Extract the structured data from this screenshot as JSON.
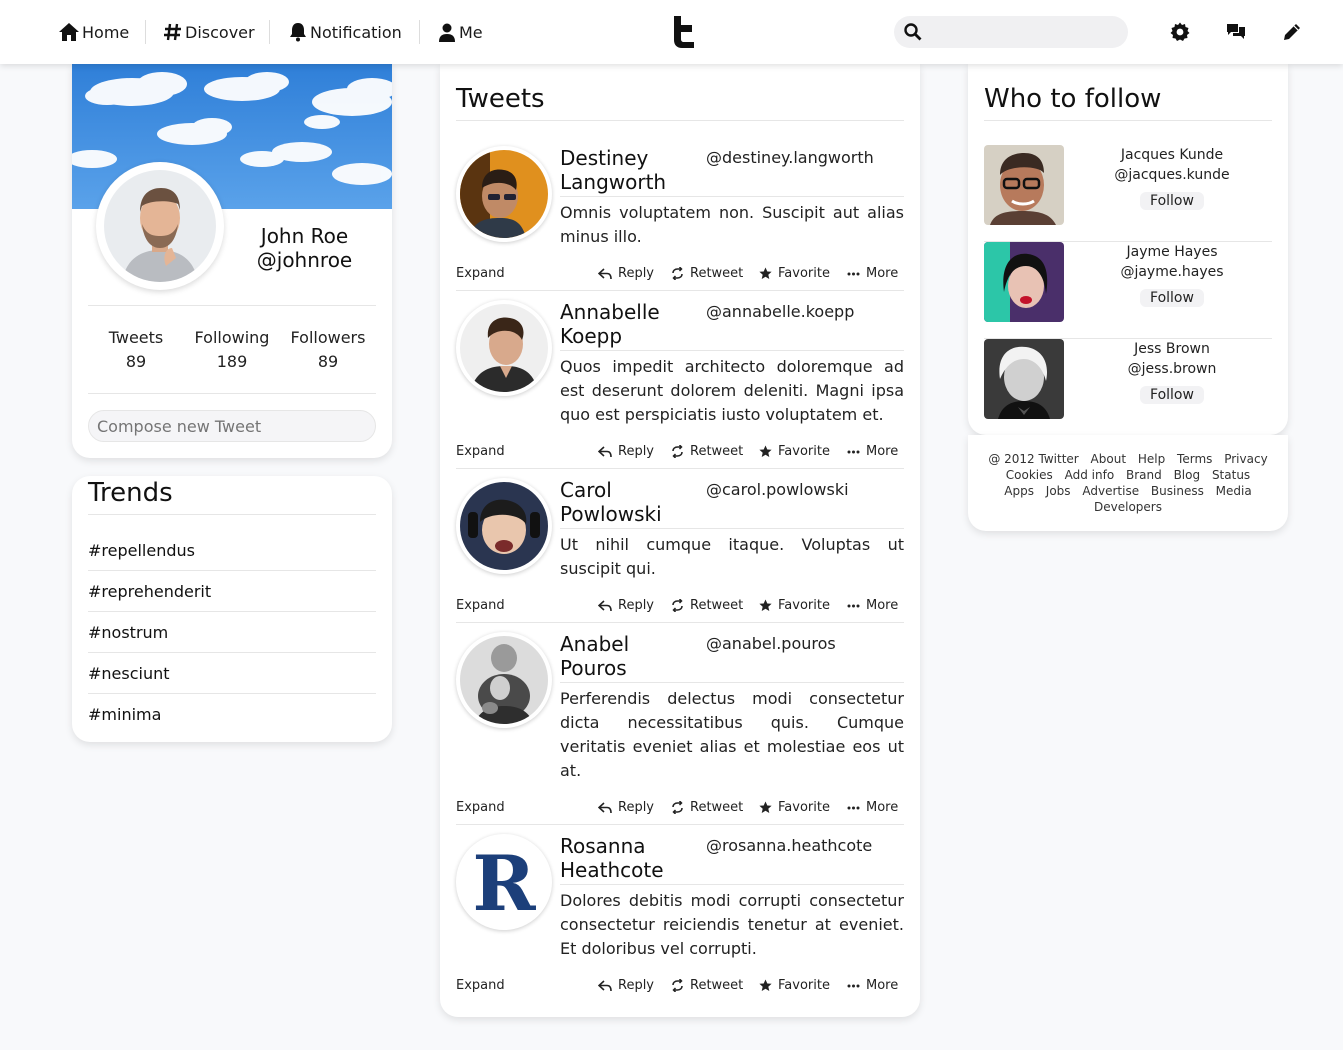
{
  "nav": {
    "home": "Home",
    "discover": "Discover",
    "notification": "Notification",
    "me": "Me",
    "search_placeholder": ""
  },
  "profile": {
    "name": "John Roe",
    "handle": "@johnroe",
    "stats": [
      {
        "label": "Tweets",
        "value": "89"
      },
      {
        "label": "Following",
        "value": "189"
      },
      {
        "label": "Followers",
        "value": "89"
      }
    ],
    "compose_placeholder": "Compose new Tweet"
  },
  "trends": {
    "title": "Trends",
    "items": [
      "#repellendus",
      "#reprehenderit",
      "#nostrum",
      "#nesciunt",
      "#minima"
    ]
  },
  "tweets": {
    "title": "Tweets",
    "actions": {
      "expand": "Expand",
      "reply": "Reply",
      "retweet": "Retweet",
      "favorite": "Favorite",
      "more": "More"
    },
    "items": [
      {
        "name": "Destiney Langworth",
        "handle": "@destiney.langworth",
        "body": "Omnis voluptatem non. Suscipit aut alias minus illo."
      },
      {
        "name": "Annabelle Koepp",
        "handle": "@annabelle.koepp",
        "body": "Quos impedit architecto doloremque ad est deserunt dolorem deleniti. Magni ipsa quo est perspiciatis iusto voluptatem et."
      },
      {
        "name": "Carol Powlowski",
        "handle": "@carol.powlowski",
        "body": "Ut nihil cumque itaque. Voluptas ut suscipit qui."
      },
      {
        "name": "Anabel Pouros",
        "handle": "@anabel.pouros",
        "body": "Perferendis delectus modi consectetur dicta necessitatibus quis. Cumque veritatis eveniet alias et molestiae eos ut at."
      },
      {
        "name": "Rosanna Heathcote",
        "handle": "@rosanna.heathcote",
        "body": "Dolores debitis modi corrupti consectetur consectetur reiciendis tenetur at eveniet. Et doloribus vel corrupti."
      }
    ]
  },
  "who_to_follow": {
    "title": "Who to follow",
    "follow_label": "Follow",
    "items": [
      {
        "name": "Jacques Kunde",
        "handle": "@jacques.kunde"
      },
      {
        "name": "Jayme Hayes",
        "handle": "@jayme.hayes"
      },
      {
        "name": "Jess Brown",
        "handle": "@jess.brown"
      }
    ]
  },
  "footer": {
    "links": [
      "@ 2012 Twitter",
      "About",
      "Help",
      "Terms",
      "Privacy",
      "Cookies",
      "Add info",
      "Brand",
      "Blog",
      "Status",
      "Apps",
      "Jobs",
      "Advertise",
      "Business",
      "Media",
      "Developers"
    ]
  },
  "icons": {
    "home": "home-icon",
    "discover": "hashtag-icon",
    "notification": "bell-icon",
    "me": "user-icon",
    "brand": "twitter-t-logo-icon",
    "search": "search-icon",
    "settings": "gear-icon",
    "messages": "chat-bubbles-icon",
    "compose": "pencil-icon",
    "reply": "reply-icon",
    "retweet": "retweet-icon",
    "favorite": "star-icon",
    "more": "ellipsis-icon"
  },
  "colors": {
    "page_bg": "#f8f9fb",
    "card_bg": "#ffffff",
    "divider": "#e6e6e6",
    "sky": "#3f8ee0"
  }
}
